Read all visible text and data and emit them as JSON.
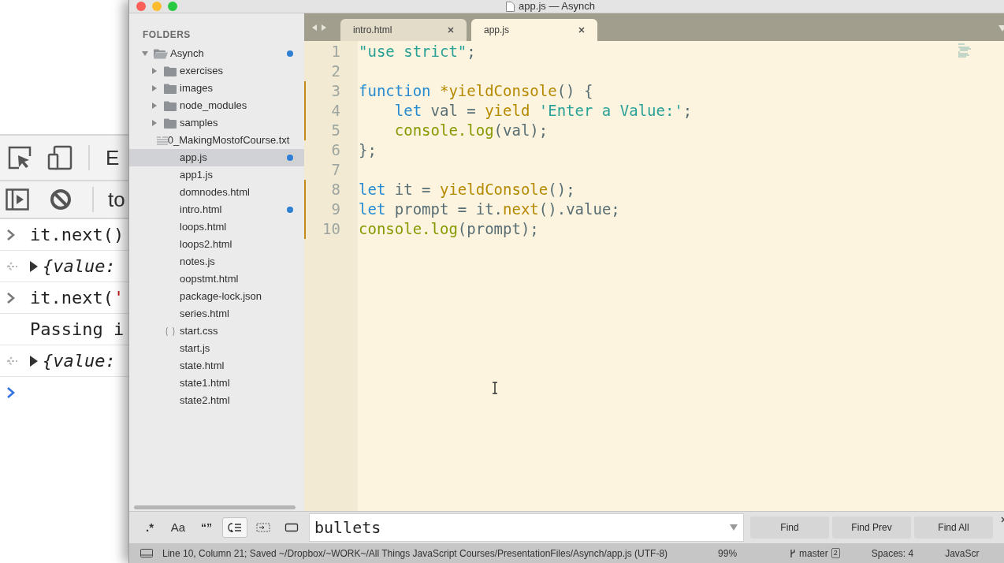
{
  "background_console": {
    "toolbar_text": "E",
    "context_text": "to",
    "rows": [
      {
        "kind": "input",
        "parts": [
          {
            "text": "it.next()",
            "kind": "plain"
          }
        ]
      },
      {
        "kind": "output",
        "parts": [
          {
            "text": "{value:",
            "kind": "plain"
          }
        ]
      },
      {
        "kind": "input",
        "parts": [
          {
            "text": "it.next(",
            "kind": "plain"
          },
          {
            "text": "'",
            "kind": "string"
          }
        ]
      },
      {
        "kind": "log",
        "parts": [
          {
            "text": "Passing i",
            "kind": "plain"
          }
        ]
      },
      {
        "kind": "output",
        "parts": [
          {
            "text": "{value:",
            "kind": "plain"
          }
        ]
      },
      {
        "kind": "prompt",
        "parts": []
      }
    ]
  },
  "window": {
    "title": "app.js — Asynch"
  },
  "sidebar": {
    "heading": "FOLDERS",
    "items": [
      {
        "label": "Asynch",
        "kind": "folder",
        "expanded": true,
        "modified": true,
        "selected": false,
        "children": [
          {
            "label": "exercises",
            "kind": "folder",
            "expanded": false,
            "modified": false,
            "selected": false
          },
          {
            "label": "images",
            "kind": "folder",
            "expanded": false,
            "modified": false,
            "selected": false
          },
          {
            "label": "node_modules",
            "kind": "folder",
            "expanded": false,
            "modified": false,
            "selected": false
          },
          {
            "label": "samples",
            "kind": "folder",
            "expanded": false,
            "modified": false,
            "selected": false
          },
          {
            "label": "0_MakingMostofCourse.txt",
            "kind": "text",
            "modified": false,
            "selected": false
          },
          {
            "label": "app.js",
            "kind": "file",
            "modified": true,
            "selected": true
          },
          {
            "label": "app1.js",
            "kind": "file",
            "modified": false,
            "selected": false
          },
          {
            "label": "domnodes.html",
            "kind": "file",
            "modified": false,
            "selected": false
          },
          {
            "label": "intro.html",
            "kind": "file",
            "modified": true,
            "selected": false
          },
          {
            "label": "loops.html",
            "kind": "file",
            "modified": false,
            "selected": false
          },
          {
            "label": "loops2.html",
            "kind": "file",
            "modified": false,
            "selected": false
          },
          {
            "label": "notes.js",
            "kind": "file",
            "modified": false,
            "selected": false
          },
          {
            "label": "oopstmt.html",
            "kind": "file",
            "modified": false,
            "selected": false
          },
          {
            "label": "package-lock.json",
            "kind": "file",
            "modified": false,
            "selected": false
          },
          {
            "label": "series.html",
            "kind": "file",
            "modified": false,
            "selected": false
          },
          {
            "label": "start.css",
            "kind": "style",
            "modified": false,
            "selected": false
          },
          {
            "label": "start.js",
            "kind": "file",
            "modified": false,
            "selected": false
          },
          {
            "label": "state.html",
            "kind": "file",
            "modified": false,
            "selected": false
          },
          {
            "label": "state1.html",
            "kind": "file",
            "modified": false,
            "selected": false
          },
          {
            "label": "state2.html",
            "kind": "file",
            "modified": false,
            "selected": false
          }
        ]
      }
    ]
  },
  "tabs": [
    {
      "label": "intro.html",
      "selected": false
    },
    {
      "label": "app.js",
      "selected": true
    }
  ],
  "editor": {
    "lines": [
      {
        "number": "1",
        "modified": false,
        "tokens": [
          {
            "text": "\"use strict\"",
            "kind": "string"
          },
          {
            "text": ";",
            "kind": "plain"
          }
        ]
      },
      {
        "number": "2",
        "modified": false
      },
      {
        "number": "3",
        "modified": true,
        "tokens": [
          {
            "text": "function ",
            "kind": "keyword"
          },
          {
            "text": "*yieldConsole",
            "kind": "name"
          },
          {
            "text": "() {",
            "kind": "plain"
          }
        ]
      },
      {
        "number": "4",
        "modified": true,
        "tokens": [
          {
            "text": "    let",
            "kind": "keyword"
          },
          {
            "text": " val = ",
            "kind": "plain"
          },
          {
            "text": "yield",
            "kind": "name"
          },
          {
            "text": " 'Enter a Value:'",
            "kind": "string"
          },
          {
            "text": ";",
            "kind": "plain"
          }
        ]
      },
      {
        "number": "5",
        "modified": true,
        "tokens": [
          {
            "text": "    console.log",
            "kind": "call"
          },
          {
            "text": "(val);",
            "kind": "plain"
          }
        ]
      },
      {
        "number": "6",
        "modified": false,
        "tokens": [
          {
            "text": "};",
            "kind": "plain"
          }
        ]
      },
      {
        "number": "7",
        "modified": false
      },
      {
        "number": "8",
        "modified": true,
        "tokens": [
          {
            "text": "let",
            "kind": "keyword"
          },
          {
            "text": " it = ",
            "kind": "plain"
          },
          {
            "text": "yieldConsole",
            "kind": "name"
          },
          {
            "text": "();",
            "kind": "plain"
          }
        ]
      },
      {
        "number": "9",
        "modified": true,
        "tokens": [
          {
            "text": "let",
            "kind": "keyword"
          },
          {
            "text": " prompt = it.",
            "kind": "plain"
          },
          {
            "text": "next",
            "kind": "name"
          },
          {
            "text": "().value;",
            "kind": "plain"
          }
        ]
      },
      {
        "number": "10",
        "modified": true,
        "tokens": [
          {
            "text": "console.log",
            "kind": "call"
          },
          {
            "text": "(prompt);",
            "kind": "plain"
          }
        ]
      }
    ]
  },
  "find_bar": {
    "toggles": [
      {
        "kind": "regex",
        "label": ".*",
        "on": false
      },
      {
        "kind": "case",
        "label": "Aa",
        "on": false
      },
      {
        "kind": "word",
        "label": "“”",
        "on": false
      },
      {
        "kind": "wrap",
        "on": true
      },
      {
        "kind": "selection",
        "on": false
      },
      {
        "kind": "highlight",
        "on": false
      }
    ],
    "value": "bullets",
    "buttons": [
      "Find",
      "Find Prev",
      "Find All"
    ]
  },
  "status_bar": {
    "position": "Line 10, Column 21; Saved ~/Dropbox/~WORK~/All Things JavaScript Courses/PresentationFiles/Asynch/app.js (UTF-8)",
    "zoom": "99%",
    "branch": "master",
    "changes": "2",
    "indent": "Spaces: 4",
    "syntax": "JavaScr"
  }
}
